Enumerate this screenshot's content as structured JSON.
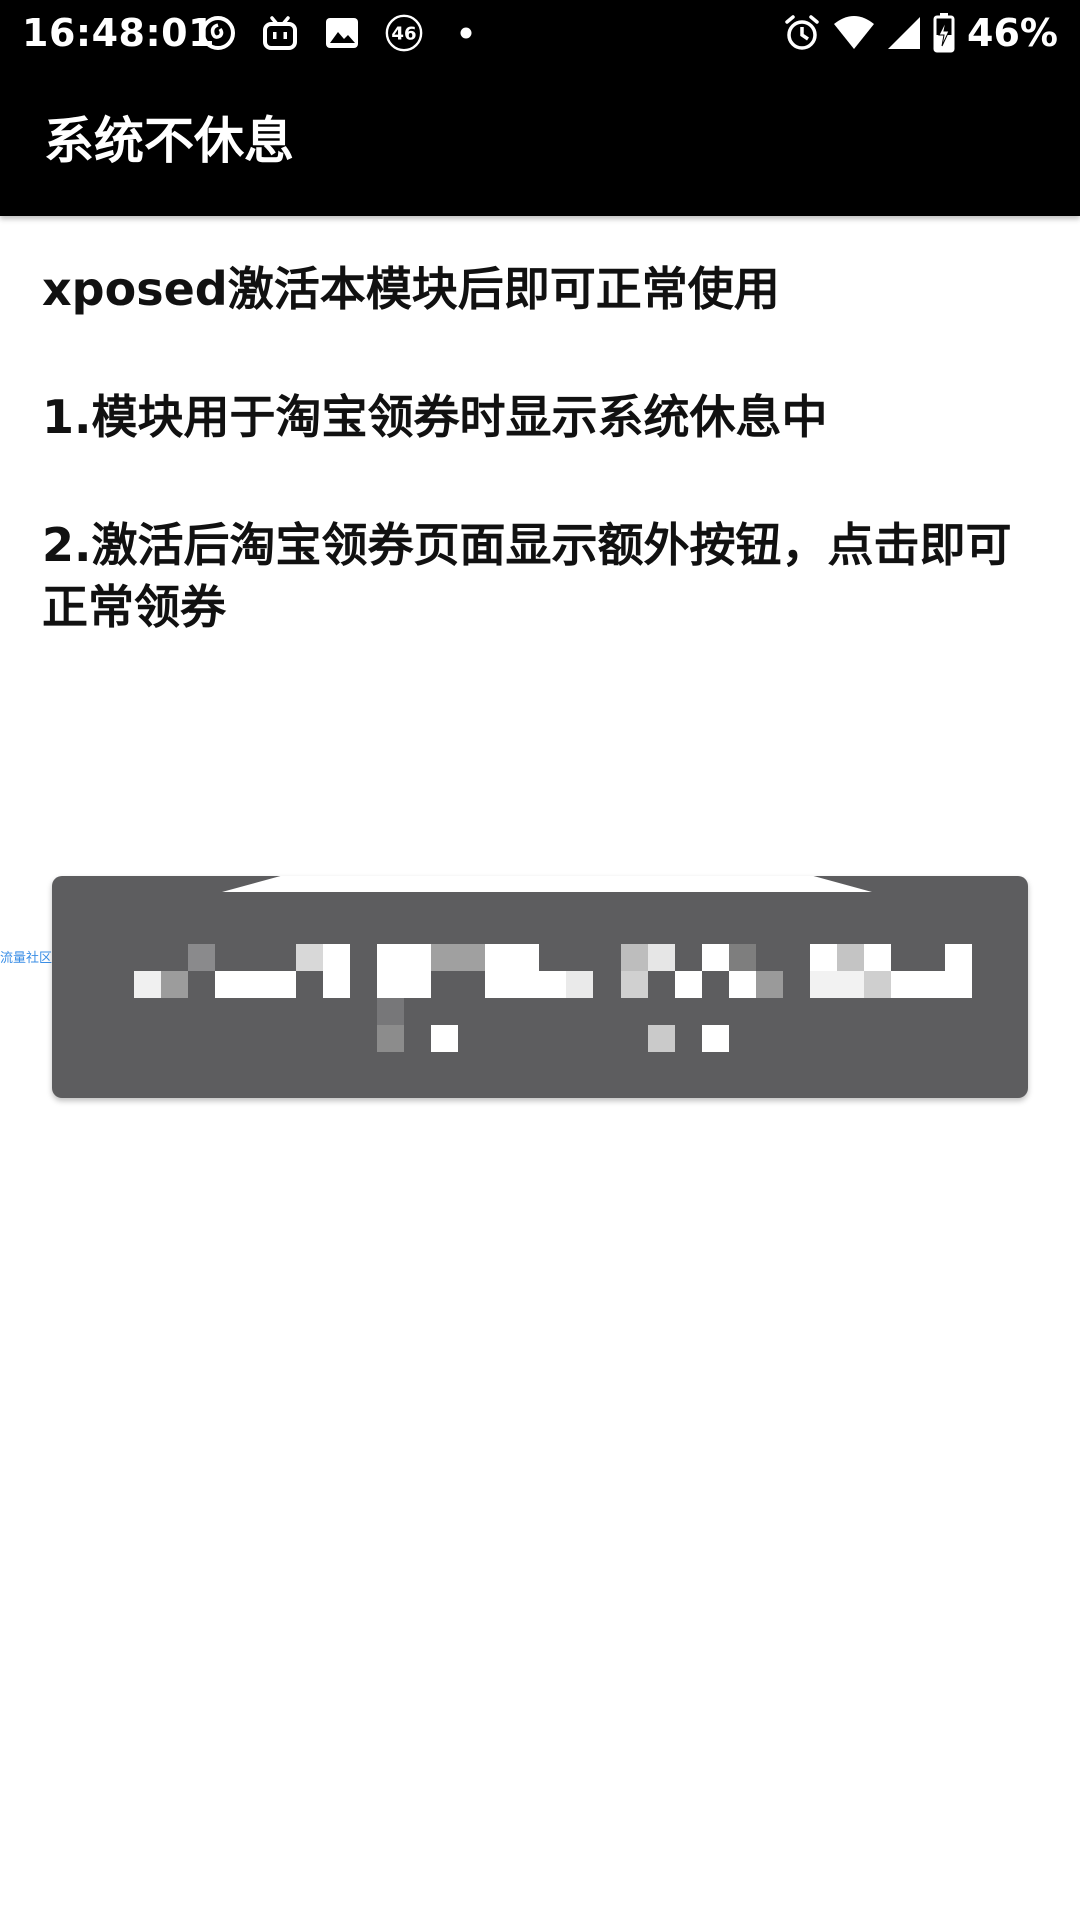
{
  "status_bar": {
    "time": "16:48:01",
    "network_badge": "46",
    "battery_percent": "46%",
    "left_icons": [
      "netease-music-icon",
      "bilibili-icon",
      "gallery-image-icon",
      "network-46-icon",
      "dot-indicator-icon"
    ],
    "right_icons": [
      "alarm-icon",
      "wifi-icon",
      "cellular-signal-icon",
      "battery-charging-icon"
    ]
  },
  "appbar": {
    "title": "系统不休息"
  },
  "content": {
    "paragraphs": [
      "xposed激活本模块后即可正常使用",
      "1.模块用于淘宝领券时显示系统休息中",
      "2.激活后淘宝领券页面显示额外按钮，点击即可正常领券"
    ]
  },
  "side_watermark": "流量社区",
  "colors": {
    "bar_background": "#000000",
    "page_background": "#ffffff",
    "toast_background": "#5d5d5f",
    "text": "#111111"
  }
}
